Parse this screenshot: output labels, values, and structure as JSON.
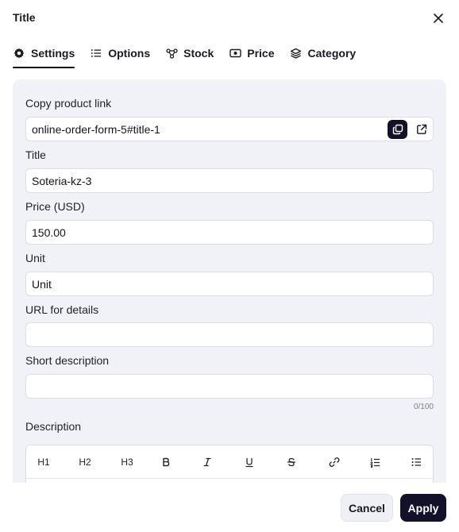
{
  "dialog": {
    "title": "Title"
  },
  "tabs": [
    {
      "label": "Settings",
      "icon": "gear-icon",
      "active": true
    },
    {
      "label": "Options",
      "icon": "list-icon",
      "active": false
    },
    {
      "label": "Stock",
      "icon": "nodes-icon",
      "active": false
    },
    {
      "label": "Price",
      "icon": "banknote-icon",
      "active": false
    },
    {
      "label": "Category",
      "icon": "layers-icon",
      "active": false
    }
  ],
  "form": {
    "copy_link": {
      "label": "Copy product link",
      "value": "online-order-form-5#title-1"
    },
    "title": {
      "label": "Title",
      "value": "Soteria-kz-3"
    },
    "price": {
      "label": "Price (USD)",
      "value": "150.00"
    },
    "unit": {
      "label": "Unit",
      "value": "Unit"
    },
    "url_details": {
      "label": "URL for details",
      "value": ""
    },
    "short_description": {
      "label": "Short description",
      "value": "",
      "counter": "0/100"
    },
    "description": {
      "label": "Description"
    }
  },
  "editor_toolbar": [
    {
      "label": "H1",
      "icon": "heading-1-icon"
    },
    {
      "label": "H2",
      "icon": "heading-2-icon"
    },
    {
      "label": "H3",
      "icon": "heading-3-icon"
    },
    {
      "label": "",
      "icon": "bold-icon"
    },
    {
      "label": "",
      "icon": "italic-icon"
    },
    {
      "label": "",
      "icon": "underline-icon"
    },
    {
      "label": "",
      "icon": "strikethrough-icon"
    },
    {
      "label": "",
      "icon": "link-icon"
    },
    {
      "label": "",
      "icon": "ordered-list-icon"
    },
    {
      "label": "",
      "icon": "bullet-list-icon"
    }
  ],
  "footer": {
    "cancel_label": "Cancel",
    "apply_label": "Apply"
  },
  "colors": {
    "accent": "#13112a",
    "panel_bg": "#f1f2f7",
    "border": "#dcdde6"
  }
}
